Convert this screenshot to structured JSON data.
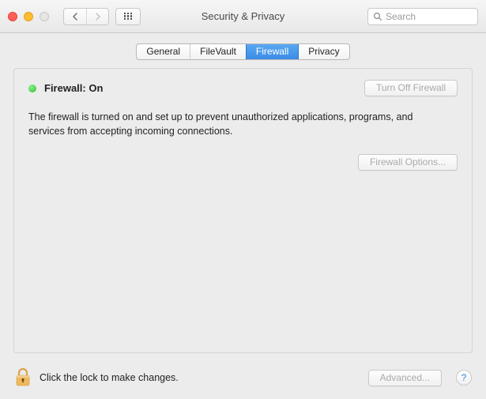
{
  "window": {
    "title": "Security & Privacy"
  },
  "search": {
    "placeholder": "Search",
    "value": ""
  },
  "tabs": [
    {
      "label": "General"
    },
    {
      "label": "FileVault"
    },
    {
      "label": "Firewall"
    },
    {
      "label": "Privacy"
    }
  ],
  "firewall": {
    "status_label": "Firewall: On",
    "status_color": "#2bbf2b",
    "description": "The firewall is turned on and set up to prevent unauthorized applications, programs, and services from accepting incoming connections.",
    "turn_off_label": "Turn Off Firewall",
    "options_label": "Firewall Options..."
  },
  "footer": {
    "lock_text": "Click the lock to make changes.",
    "advanced_label": "Advanced...",
    "help_label": "?"
  }
}
